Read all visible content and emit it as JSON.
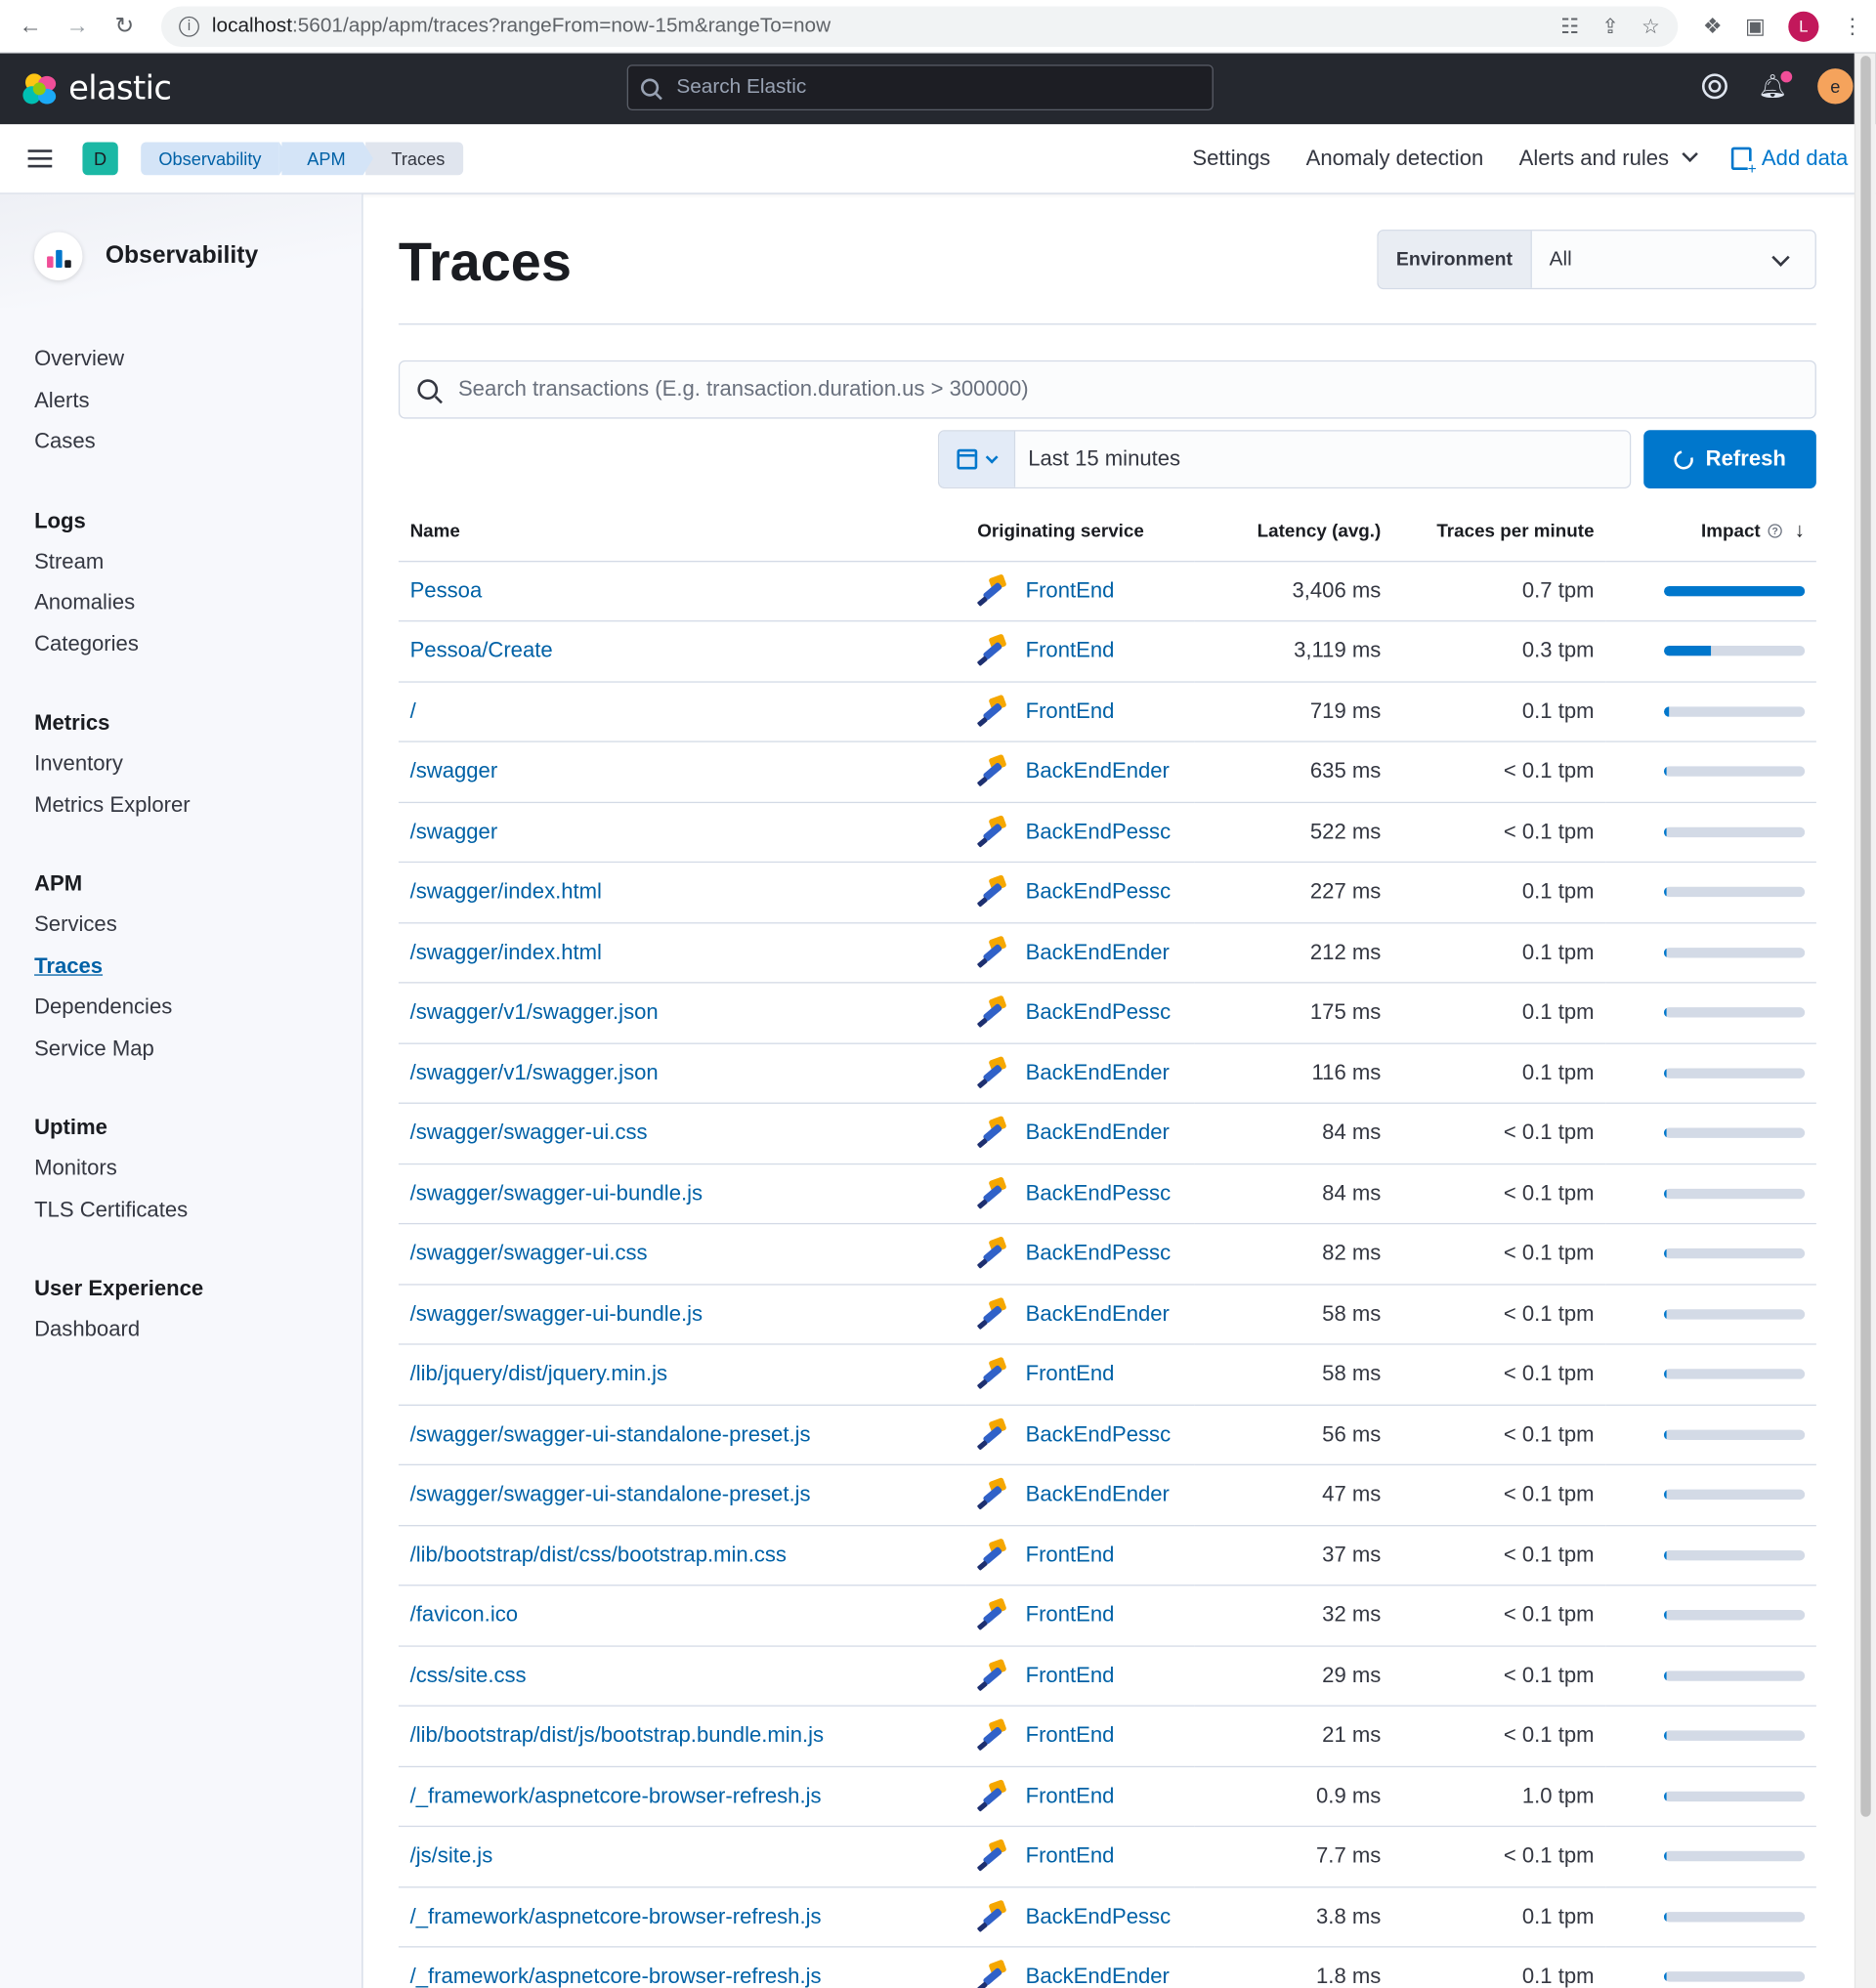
{
  "browser": {
    "url_host": "localhost",
    "url_path": ":5601/app/apm/traces?rangeFrom=now-15m&rangeTo=now",
    "profile_initial": "L"
  },
  "header": {
    "logo_text": "elastic",
    "search_placeholder": "Search Elastic",
    "user_initial": "e"
  },
  "appbar": {
    "space_initial": "D",
    "breadcrumbs": [
      "Observability",
      "APM",
      "Traces"
    ],
    "settings_label": "Settings",
    "anomaly_label": "Anomaly detection",
    "alerts_label": "Alerts and rules",
    "add_data_label": "Add data"
  },
  "sidebar": {
    "title": "Observability",
    "top_items": [
      "Overview",
      "Alerts",
      "Cases"
    ],
    "groups": [
      {
        "title": "Logs",
        "items": [
          "Stream",
          "Anomalies",
          "Categories"
        ]
      },
      {
        "title": "Metrics",
        "items": [
          "Inventory",
          "Metrics Explorer"
        ]
      },
      {
        "title": "APM",
        "items": [
          "Services",
          "Traces",
          "Dependencies",
          "Service Map"
        ]
      },
      {
        "title": "Uptime",
        "items": [
          "Monitors",
          "TLS Certificates"
        ]
      },
      {
        "title": "User Experience",
        "items": [
          "Dashboard"
        ]
      }
    ],
    "active_item": "Traces"
  },
  "main": {
    "title": "Traces",
    "environment_label": "Environment",
    "environment_value": "All",
    "search_placeholder": "Search transactions (E.g. transaction.duration.us > 300000)",
    "date_range": "Last 15 minutes",
    "refresh_label": "Refresh"
  },
  "table": {
    "columns": [
      "Name",
      "Originating service",
      "Latency (avg.)",
      "Traces per minute",
      "Impact"
    ],
    "rows": [
      {
        "name": "Pessoa",
        "service": "FrontEnd",
        "latency": "3,406 ms",
        "tpm": "0.7 tpm",
        "impact": 100
      },
      {
        "name": "Pessoa/Create",
        "service": "FrontEnd",
        "latency": "3,119 ms",
        "tpm": "0.3 tpm",
        "impact": 33
      },
      {
        "name": "/",
        "service": "FrontEnd",
        "latency": "719 ms",
        "tpm": "0.1 tpm",
        "impact": 4
      },
      {
        "name": "/swagger",
        "service": "BackEndEnder",
        "latency": "635 ms",
        "tpm": "< 0.1 tpm",
        "impact": 1
      },
      {
        "name": "/swagger",
        "service": "BackEndPessc",
        "latency": "522 ms",
        "tpm": "< 0.1 tpm",
        "impact": 1
      },
      {
        "name": "/swagger/index.html",
        "service": "BackEndPessc",
        "latency": "227 ms",
        "tpm": "0.1 tpm",
        "impact": 1
      },
      {
        "name": "/swagger/index.html",
        "service": "BackEndEnder",
        "latency": "212 ms",
        "tpm": "0.1 tpm",
        "impact": 1
      },
      {
        "name": "/swagger/v1/swagger.json",
        "service": "BackEndPessc",
        "latency": "175 ms",
        "tpm": "0.1 tpm",
        "impact": 0
      },
      {
        "name": "/swagger/v1/swagger.json",
        "service": "BackEndEnder",
        "latency": "116 ms",
        "tpm": "0.1 tpm",
        "impact": 0
      },
      {
        "name": "/swagger/swagger-ui.css",
        "service": "BackEndEnder",
        "latency": "84 ms",
        "tpm": "< 0.1 tpm",
        "impact": 0
      },
      {
        "name": "/swagger/swagger-ui-bundle.js",
        "service": "BackEndPessc",
        "latency": "84 ms",
        "tpm": "< 0.1 tpm",
        "impact": 0
      },
      {
        "name": "/swagger/swagger-ui.css",
        "service": "BackEndPessc",
        "latency": "82 ms",
        "tpm": "< 0.1 tpm",
        "impact": 0
      },
      {
        "name": "/swagger/swagger-ui-bundle.js",
        "service": "BackEndEnder",
        "latency": "58 ms",
        "tpm": "< 0.1 tpm",
        "impact": 0
      },
      {
        "name": "/lib/jquery/dist/jquery.min.js",
        "service": "FrontEnd",
        "latency": "58 ms",
        "tpm": "< 0.1 tpm",
        "impact": 0
      },
      {
        "name": "/swagger/swagger-ui-standalone-preset.js",
        "service": "BackEndPessc",
        "latency": "56 ms",
        "tpm": "< 0.1 tpm",
        "impact": 0
      },
      {
        "name": "/swagger/swagger-ui-standalone-preset.js",
        "service": "BackEndEnder",
        "latency": "47 ms",
        "tpm": "< 0.1 tpm",
        "impact": 0
      },
      {
        "name": "/lib/bootstrap/dist/css/bootstrap.min.css",
        "service": "FrontEnd",
        "latency": "37 ms",
        "tpm": "< 0.1 tpm",
        "impact": 0
      },
      {
        "name": "/favicon.ico",
        "service": "FrontEnd",
        "latency": "32 ms",
        "tpm": "< 0.1 tpm",
        "impact": 0
      },
      {
        "name": "/css/site.css",
        "service": "FrontEnd",
        "latency": "29 ms",
        "tpm": "< 0.1 tpm",
        "impact": 0
      },
      {
        "name": "/lib/bootstrap/dist/js/bootstrap.bundle.min.js",
        "service": "FrontEnd",
        "latency": "21 ms",
        "tpm": "< 0.1 tpm",
        "impact": 0
      },
      {
        "name": "/_framework/aspnetcore-browser-refresh.js",
        "service": "FrontEnd",
        "latency": "0.9 ms",
        "tpm": "1.0 tpm",
        "impact": 0
      },
      {
        "name": "/js/site.js",
        "service": "FrontEnd",
        "latency": "7.7 ms",
        "tpm": "< 0.1 tpm",
        "impact": 0
      },
      {
        "name": "/_framework/aspnetcore-browser-refresh.js",
        "service": "BackEndPessc",
        "latency": "3.8 ms",
        "tpm": "0.1 tpm",
        "impact": 0
      },
      {
        "name": "/_framework/aspnetcore-browser-refresh.js",
        "service": "BackEndEnder",
        "latency": "1.8 ms",
        "tpm": "0.1 tpm",
        "impact": 0
      }
    ]
  },
  "colors": {
    "accent": "#0077cc",
    "link": "#0061a6",
    "header_bg": "#25282f",
    "impact_track": "#d3dae6"
  }
}
